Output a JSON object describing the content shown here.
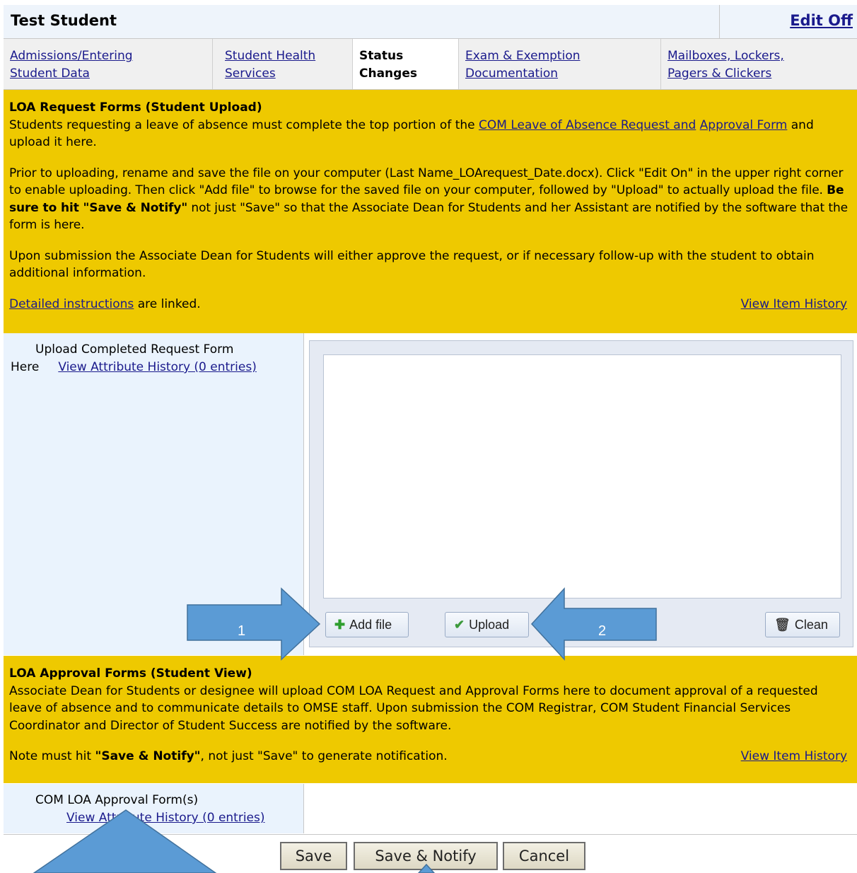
{
  "header": {
    "title": "Test Student",
    "edit_toggle": "Edit Off"
  },
  "tabs": [
    {
      "line1": "Admissions/Entering",
      "line2": "Student Data",
      "active": false
    },
    {
      "line1": "Student Health",
      "line2": "Services",
      "active": false
    },
    {
      "line1": "Status",
      "line2": "Changes",
      "active": true
    },
    {
      "line1": "Exam & Exemption",
      "line2": "Documentation",
      "active": false
    },
    {
      "line1": "Mailboxes, Lockers,",
      "line2": "Pagers & Clickers",
      "active": false
    }
  ],
  "loa_request": {
    "heading": "LOA Request Forms (Student Upload)",
    "p1_before": "Students requesting a leave of absence must complete the top portion of the ",
    "p1_link_a": "COM Leave of Absence Request and",
    "p1_link_b": "Approval Form",
    "p1_after": " and upload it here.",
    "p2_before": "Prior to uploading, rename and save the file on your computer (Last Name_LOArequest_Date.docx). Click \"Edit On\" in the upper right corner to enable uploading. Then click \"Add file\" to browse for the saved file on your computer, followed by \"Upload\" to actually upload the file. ",
    "p2_bold": "Be sure to hit \"Save & Notify\"",
    "p2_after": " not just \"Save\" so that the Associate Dean for Students and her Assistant are notified by the software that the form is here.",
    "p3": "Upon submission the Associate Dean for Students will either approve the request, or if necessary follow-up with the student to obtain additional information.",
    "instructions_link": "Detailed instructions",
    "instructions_after": " are linked.",
    "history_link": "View Item History"
  },
  "upload_field": {
    "label_line1": "Upload Completed Request Form",
    "label_line2": "Here",
    "history_link": "View Attribute History (0 entries)",
    "add_file": "Add file",
    "upload": "Upload",
    "clean": "Clean"
  },
  "loa_approval": {
    "heading": "LOA Approval Forms (Student View)",
    "p1": "Associate Dean for Students or designee will upload COM LOA Request and Approval Forms here to document approval of a requested leave of absence and to communicate details to OMSE staff. Upon submission the COM Registrar, COM Student Financial Services Coordinator and Director of Student Success are notified by the software.",
    "note_before": "Note must hit ",
    "note_bold": "\"Save & Notify\"",
    "note_after": ", not just \"Save\" to generate notification.",
    "history_link": "View Item History"
  },
  "approval_field": {
    "label": "COM LOA Approval Form(s)",
    "history_link": "View Attribute History (0 entries)"
  },
  "buttons": {
    "save": "Save",
    "save_notify": "Save & Notify",
    "cancel": "Cancel"
  },
  "annotations": {
    "arrow1": "1",
    "arrow2": "2",
    "arrow_color": "#5b9bd5"
  },
  "colors": {
    "section_yellow": "#eec900",
    "label_cell_blue": "#eaf3fd",
    "link_blue": "#1a1a8c"
  }
}
